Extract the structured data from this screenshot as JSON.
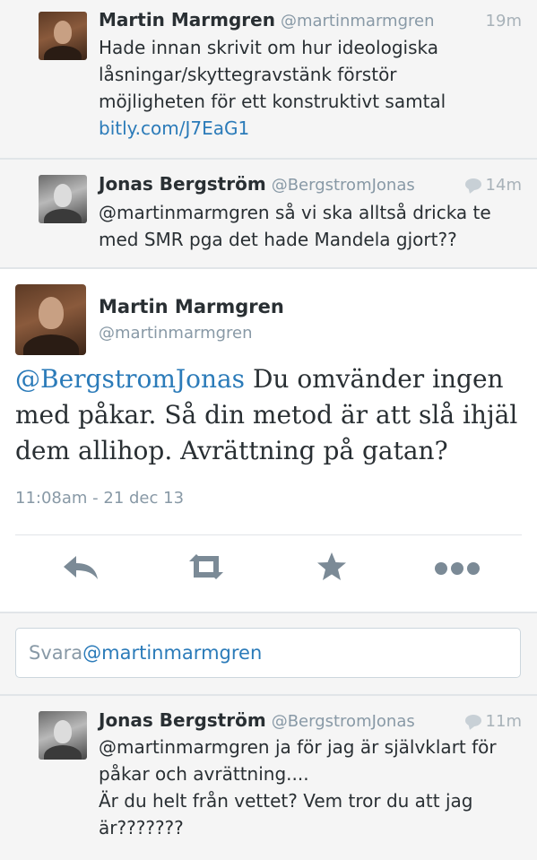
{
  "tweets": [
    {
      "name": "Martin Marmgren",
      "handle": "@martinmarmgren",
      "time": "19m",
      "text": "Hade innan skrivit om hur ideologiska\nlåsningar/skyttegravstänk förstör\nmöjligheten för ett konstruktivt samtal",
      "link": "bitly.com/J7EaG1"
    },
    {
      "name": "Jonas Bergström",
      "handle": "@BergstromJonas",
      "time": "14m",
      "text": "@martinmarmgren så vi ska alltså dricka te\nmed SMR pga det hade Mandela gjort??"
    }
  ],
  "focused": {
    "name": "Martin Marmgren",
    "handle": "@martinmarmgren",
    "mention": "@BergstromJonas",
    "text": " Du omvänder ingen med påkar. Så din metod är att slå ihjäl dem allihop. Avrättning på gatan?",
    "date": "11:08am - 21 dec 13",
    "actions": [
      "reply-icon",
      "retweet-icon",
      "favorite-icon",
      "more-icon"
    ]
  },
  "reply_box": {
    "prefix": "Svara",
    "mention": "@martinmarmgren"
  },
  "reply_tweet": {
    "name": "Jonas Bergström",
    "handle": "@BergstromJonas",
    "time": "11m",
    "text": "@martinmarmgren ja för jag är självklart för\npåkar och avrättning....\nÄr du helt från vettet? Vem tror du att jag\när???????"
  },
  "colors": {
    "link": "#2b7bb9",
    "muted": "#8899a6",
    "background": "#f5f5f5"
  }
}
